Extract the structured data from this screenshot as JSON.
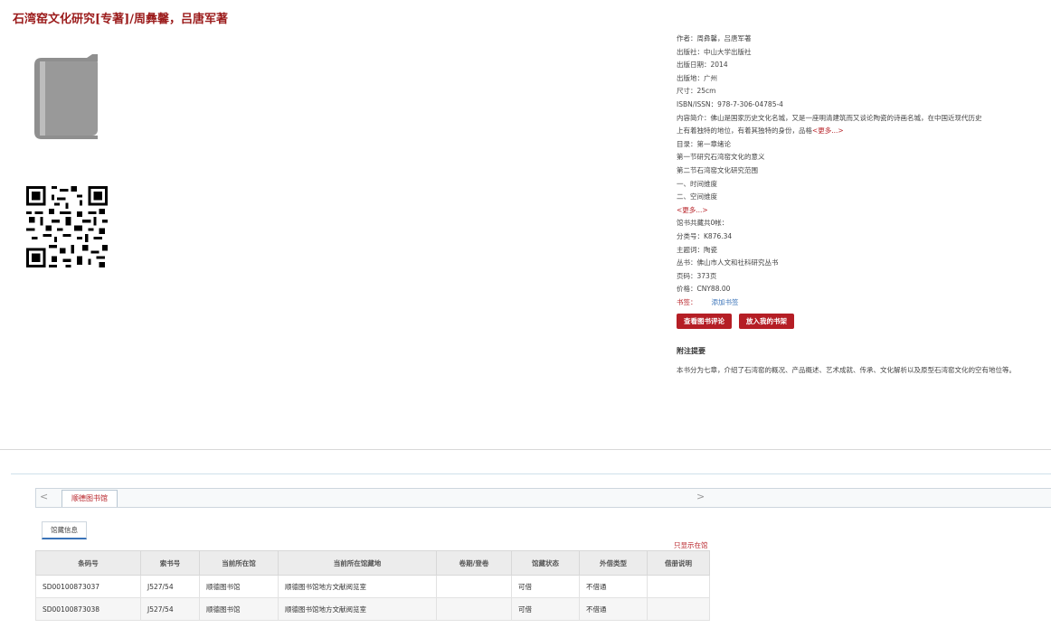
{
  "title": "石湾窑文化研究[专著]/周彝馨，吕唐军著",
  "info": {
    "author": "作者：周彝馨，吕唐军著",
    "publisher": "出版社：中山大学出版社",
    "pub_date": "出版日期：2014",
    "pub_place": "出版地：广州",
    "size": "尺寸：25cm",
    "isbn": "ISBN/ISSN：978-7-306-04785-4",
    "summary_1": "内容简介：佛山是国家历史文化名城，又是一座明清建筑而又谈论陶瓷的诗画名城，在中国近现代历史",
    "summary_2": "上有着独特的地位，有着其独特的身份，品格",
    "summary_more": "<更多...>",
    "toc_label": "目录：第一章绪论",
    "toc_1": "第一节研究石湾窑文化的意义",
    "toc_2": "第二节石湾窑文化研究范围",
    "toc_3": "一、时间维度",
    "toc_4": "二、空间维度",
    "toc_more": "<更多...>",
    "copies": "馆书共藏共0帐：",
    "class_no": "分类号：K876.34",
    "subject": "主题词：陶瓷",
    "series": "丛书：佛山市人文和社科研究丛书",
    "pages": "页码：373页",
    "price": "价格：CNY88.00",
    "tags_label": "书签：",
    "tags_link": "添加书签"
  },
  "buttons": {
    "review": "查看图书评论",
    "shelf": "放入我的书架"
  },
  "note": {
    "title": "附注提要",
    "text": "本书分为七章，介绍了石湾窑的概况、产品概述、艺术成就、传承、文化解析以及原型石湾窑文化的空有地位等。"
  },
  "tabs": {
    "prev": "<",
    "active": "顺德图书馆",
    "next": ">",
    "sub": "馆藏信息",
    "only_show": "只显示在馆"
  },
  "table": {
    "headers": [
      "条码号",
      "索书号",
      "当前所在馆",
      "当前所在馆藏地",
      "卷期/登卷",
      "馆藏状态",
      "外借类型",
      "借册说明"
    ],
    "rows": [
      [
        "SD00100873037",
        "J527/54",
        "顺德图书馆",
        "顺德图书馆地方文献阅览室",
        "",
        "可借",
        "不借通",
        ""
      ],
      [
        "SD00100873038",
        "J527/54",
        "顺德图书馆",
        "顺德图书馆地方文献阅览室",
        "",
        "可借",
        "不借通",
        ""
      ]
    ]
  },
  "colors": {
    "brand_red": "#b51e25",
    "link_blue": "#3a73b8",
    "title_red": "#9b1b1b"
  },
  "icons": {
    "book": "book-icon",
    "qr": "qr-code-icon"
  }
}
